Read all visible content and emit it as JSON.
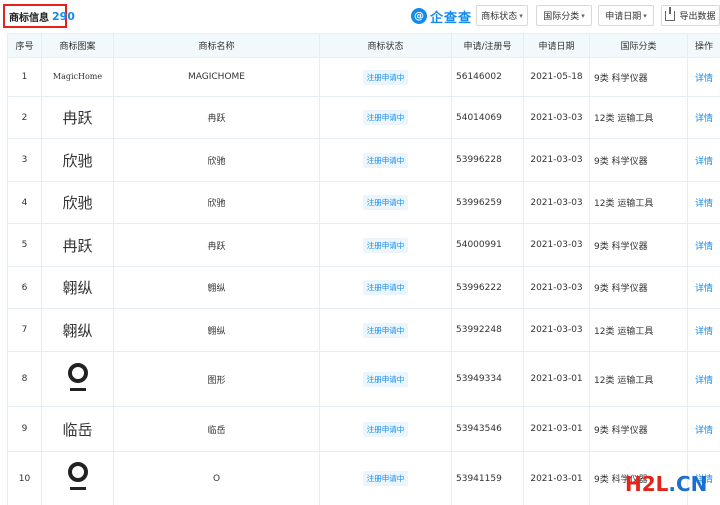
{
  "header": {
    "title": "商标信息",
    "count": "290",
    "brand": "企查查",
    "brand_mark": "@",
    "filters": [
      {
        "label": "商标状态"
      },
      {
        "label": "国际分类"
      },
      {
        "label": "申请日期"
      }
    ],
    "export_label": "导出数据",
    "accent_color": "#128bed"
  },
  "table": {
    "columns": [
      "序号",
      "商标图案",
      "商标名称",
      "商标状态",
      "申请/注册号",
      "申请日期",
      "国际分类",
      "操作"
    ],
    "rows": [
      {
        "no": "1",
        "image_text": "MagicHome",
        "image_kind": "small",
        "name": "MAGICHOME",
        "status": "注册申请中",
        "reg_no": "56146002",
        "date": "2021-05-18",
        "category": "9类 科学仪器",
        "action": "详情"
      },
      {
        "no": "2",
        "image_text": "冉跃",
        "image_kind": "text",
        "name": "冉跃",
        "status": "注册申请中",
        "reg_no": "54014069",
        "date": "2021-03-03",
        "category": "12类 运输工具",
        "action": "详情"
      },
      {
        "no": "3",
        "image_text": "欣驰",
        "image_kind": "text",
        "name": "欣驰",
        "status": "注册申请中",
        "reg_no": "53996228",
        "date": "2021-03-03",
        "category": "9类 科学仪器",
        "action": "详情"
      },
      {
        "no": "4",
        "image_text": "欣驰",
        "image_kind": "text",
        "name": "欣驰",
        "status": "注册申请中",
        "reg_no": "53996259",
        "date": "2021-03-03",
        "category": "12类 运输工具",
        "action": "详情"
      },
      {
        "no": "5",
        "image_text": "冉跃",
        "image_kind": "text",
        "name": "冉跃",
        "status": "注册申请中",
        "reg_no": "54000991",
        "date": "2021-03-03",
        "category": "9类 科学仪器",
        "action": "详情"
      },
      {
        "no": "6",
        "image_text": "翱纵",
        "image_kind": "text",
        "name": "翱纵",
        "status": "注册申请中",
        "reg_no": "53996222",
        "date": "2021-03-03",
        "category": "9类 科学仪器",
        "action": "详情"
      },
      {
        "no": "7",
        "image_text": "翱纵",
        "image_kind": "text",
        "name": "翱纵",
        "status": "注册申请中",
        "reg_no": "53992248",
        "date": "2021-03-03",
        "category": "12类 运输工具",
        "action": "详情"
      },
      {
        "no": "8",
        "image_text": "",
        "image_kind": "logo",
        "name": "图形",
        "status": "注册申请中",
        "reg_no": "53949334",
        "date": "2021-03-01",
        "category": "12类 运输工具",
        "action": "详情"
      },
      {
        "no": "9",
        "image_text": "临岳",
        "image_kind": "text",
        "name": "临岳",
        "status": "注册申请中",
        "reg_no": "53943546",
        "date": "2021-03-01",
        "category": "9类 科学仪器",
        "action": "详情"
      },
      {
        "no": "10",
        "image_text": "",
        "image_kind": "logo",
        "name": "O",
        "status": "注册申请中",
        "reg_no": "53941159",
        "date": "2021-03-01",
        "category": "9类 科学仪器",
        "action": "详情"
      }
    ]
  },
  "watermark": {
    "part_a": "H2L",
    "part_b": ".CN"
  }
}
